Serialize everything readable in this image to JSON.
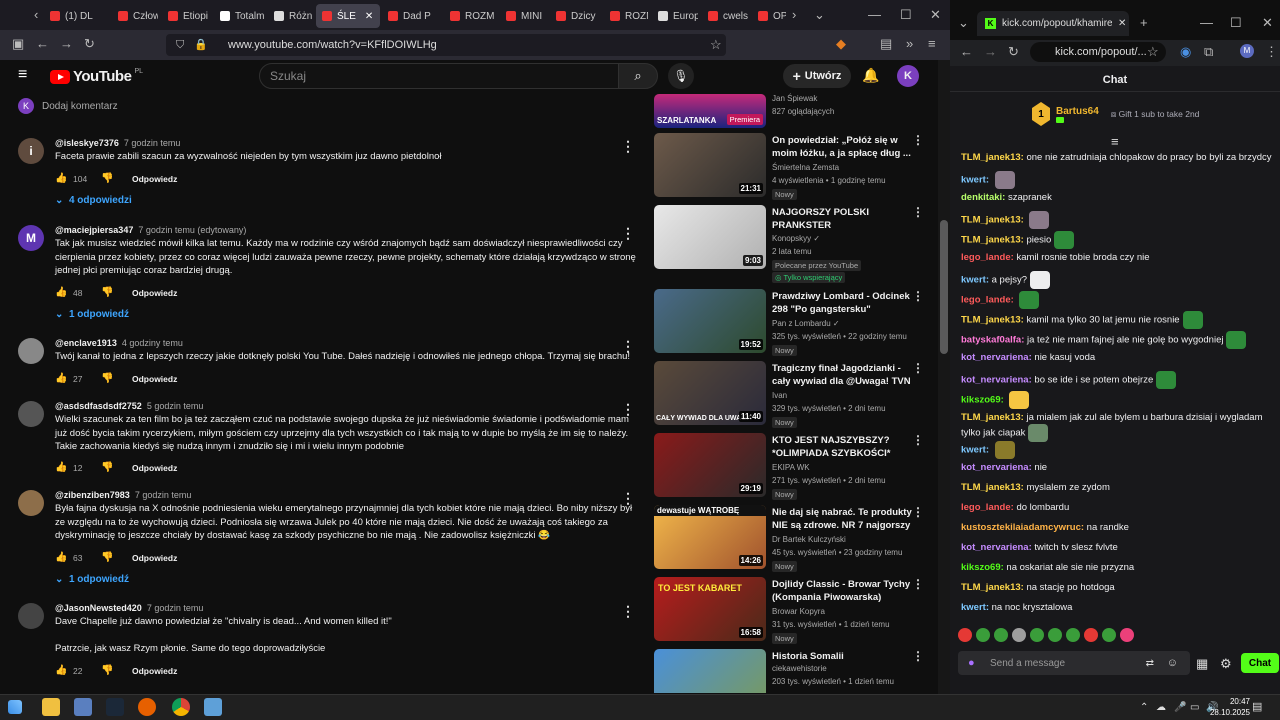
{
  "left_browser": {
    "tabs": [
      "(1) DL",
      "Człow",
      "Etiopi",
      "Totalm",
      "Różni",
      "ŚLE",
      "Dad P",
      "ROZM",
      "MINI",
      "Dzicy",
      "ROZM",
      "Europ",
      "cwels",
      "OPE"
    ],
    "url": "www.youtube.com/watch?v=KFflDOIWLHg"
  },
  "youtube": {
    "logo": "YouTube",
    "region": "PL",
    "search_placeholder": "Szukaj",
    "create_label": "Utwórz",
    "avatar_letter": "K",
    "add_comment": "Dodaj komentarz",
    "add_comment_avatar": "K",
    "comments": [
      {
        "author": "@isleskye7376",
        "time": "7 godzin temu",
        "text": "Faceta prawie zabili szacun za wyzwalność niejeden by tym wszystkim juz dawno pietdolnoł",
        "likes": "104",
        "reply": "Odpowiedz",
        "replies": "4 odpowiedzi",
        "avatar": "i",
        "color": "#5f4b3e"
      },
      {
        "author": "@maciejpiersa347",
        "time": "7 godzin temu (edytowany)",
        "text": "Tak jak musisz wiedzieć mówił kilka lat temu. Każdy ma w rodzinie czy wśród znajomych bądź sam doświadczył niesprawiedliwości czy cierpienia przez kobiety, przez co coraz więcej ludzi zauważa pewne rzeczy, pewne projekty, schematy które działają krzywdząco w stronę jednej płci premiując coraz bardziej drugą.",
        "likes": "48",
        "reply": "Odpowiedz",
        "replies": "1 odpowiedź",
        "avatar": "M",
        "color": "#5e35b1"
      },
      {
        "author": "@enclave1913",
        "time": "4 godziny temu",
        "text": "Twój kanał to jedna z lepszych rzeczy jakie dotknęły polski You Tube. Dałeś nadzieję i odnowiłeś nie jednego chłopa. Trzymaj się brachu!",
        "likes": "27",
        "reply": "Odpowiedz",
        "replies": "",
        "avatar": "",
        "color": "#888"
      },
      {
        "author": "@asdsdfasdsdf2752",
        "time": "5 godzin temu",
        "text": "Wielki szacunek za ten film bo ja też zacząłem czuć na podstawie swojego dupska że już nieświadomie świadomie i podświadomie mam już dość bycia takim rycerzykiem, miłym gościem czy uprzejmy dla tych wszystkich co i tak mają to w dupie bo myślą że im się to należy. Takie zachowania kiedyś się nudzą innym i znudziło się  i mi i wielu innym podobnie",
        "likes": "12",
        "reply": "Odpowiedz",
        "replies": "",
        "avatar": "",
        "color": "#555"
      },
      {
        "author": "@zibenziben7983",
        "time": "7 godzin temu",
        "text": "Była fajna dyskusja na X odnośnie podniesienia wieku emerytalnego przynajmniej dla tych kobiet które nie mają dzieci. Bo niby niższy był ze względu na to że wychowują dzieci. Podniosła się wrzawa Julek po 40 które nie mają dzieci. Nie dość że uważają coś takiego za dyskryminację to jeszcze chciały  by dostawać kasę za szkody psychiczne bo nie mają . Nie zadowolisz księżniczki 😂",
        "likes": "63",
        "reply": "Odpowiedz",
        "replies": "1 odpowiedź",
        "avatar": "",
        "color": "#8d6e4a"
      },
      {
        "author": "@JasonNewsted420",
        "time": "7 godzin temu",
        "text": "Dave Chapelle już dawno powiedział że \"chivalry is dead... And women killed it!\"\n\nPatrzcie, jak wasz Rzym płonie. Same do tego doprowadziłyście",
        "likes": "22",
        "reply": "Odpowiedz",
        "replies": "",
        "avatar": "",
        "color": "#444"
      }
    ],
    "recommendations": [
      {
        "title": "",
        "channel": "Jan Śpiewak",
        "meta": "827 oglądających",
        "duration": "",
        "badge": "Premiera",
        "thumb_text": "SZARLATANKA"
      },
      {
        "title": "On powiedział: „Połóż się w moim łóżku, a ja spłacę dług ...",
        "channel": "Śmiertelna Zemsta",
        "meta": "4 wyświetlenia • 1 godzinę temu",
        "duration": "21:31",
        "badge": "Nowy"
      },
      {
        "title": "NAJGORSZY POLSKI PRANKSTER",
        "channel": "Konopskyy ✓",
        "meta": "2 lata temu",
        "duration": "9:03",
        "badge": "Polecane przez YouTube",
        "badge2": "Tylko wspierający"
      },
      {
        "title": "Prawdziwy Lombard - Odcinek 298 \"Po gangstersku\"",
        "channel": "Pan z Lombardu ✓",
        "meta": "325 tys. wyświetleń • 22 godziny temu",
        "duration": "19:52",
        "badge": "Nowy"
      },
      {
        "title": "Tragiczny finał Jagodzianki - cały wywiad dla @Uwaga! TVN",
        "channel": "Ivan",
        "meta": "329 tys. wyświetleń • 2 dni temu",
        "duration": "11:40",
        "badge": "Nowy",
        "thumb_text": "CAŁY WYWIAD DLA UWAGA"
      },
      {
        "title": "KTO JEST NAJSZYBSZY? *OLIMPIADA SZYBKOŚCI*",
        "channel": "EKIPA WK",
        "meta": "271 tys. wyświetleń • 2 dni temu",
        "duration": "29:19",
        "badge": "Nowy"
      },
      {
        "title": "Nie daj się nabrać. Te produkty NIE są zdrowe. NR 7 najgorszy",
        "channel": "Dr Bartek Kulczyński",
        "meta": "45 tys. wyświetleń • 23 godziny temu",
        "duration": "14:26",
        "badge": "Nowy",
        "thumb_text": "dewastuje WĄTROBĘ"
      },
      {
        "title": "Dojlidy Classic - Browar Tychy (Kompania Piwowarska)",
        "channel": "Browar Kopyra",
        "meta": "31 tys. wyświetleń • 1 dzień temu",
        "duration": "16:58",
        "badge": "Nowy",
        "thumb_text": "TO JEST KABARET"
      },
      {
        "title": "Historia Somalii",
        "channel": "ciekawehistorie",
        "meta": "203 tys. wyświetleń • 1 dzień temu",
        "duration": "",
        "badge": ""
      }
    ]
  },
  "right_browser": {
    "tab_title": "kick.com/popout/khamires/cha",
    "url": "kick.com/popout/...",
    "chat_title": "Chat",
    "gifter": "Bartus64",
    "gifter_rank": "1",
    "gift_text": "Gift 1 sub to take 2nd",
    "messages": [
      {
        "user": "TLM_janek13:",
        "text": "one nie zatrudniaja chlopakow do pracy bo byli za brzydcy",
        "color": "#ffd84a"
      },
      {
        "user": "kwert:",
        "text": "",
        "color": "#7ec8ff"
      },
      {
        "user": "denkitaki:",
        "text": "szapranek",
        "color": "#b8ff6b"
      },
      {
        "user": "TLM_janek13:",
        "text": "",
        "color": "#ffd84a"
      },
      {
        "user": "TLM_janek13:",
        "text": "piesio",
        "color": "#ffd84a"
      },
      {
        "user": "lego_lande:",
        "text": "kamil rosnie tobie broda czy nie",
        "color": "#ff5b5b"
      },
      {
        "user": "kwert:",
        "text": "a pejsy?",
        "color": "#7ec8ff"
      },
      {
        "user": "lego_lande:",
        "text": "",
        "color": "#ff5b5b"
      },
      {
        "user": "TLM_janek13:",
        "text": "kamil ma tylko 30 lat jemu nie rosnie",
        "color": "#ffd84a"
      },
      {
        "user": "batyskaf0alfa:",
        "text": "ja też nie mam fajnej ale nie golę bo wygodniej",
        "color": "#ff7bd8"
      },
      {
        "user": "kot_nervariena:",
        "text": "nie kasuj voda",
        "color": "#c58cff"
      },
      {
        "user": "kot_nervariena:",
        "text": "bo se ide i se potem obejrze",
        "color": "#c58cff"
      },
      {
        "user": "kikszo69:",
        "text": "",
        "color": "#53fc18"
      },
      {
        "user": "TLM_janek13:",
        "text": "ja mialem jak zul ale bylem u barbura dzisiaj i wygladam tylko jak ciapak",
        "color": "#ffd84a"
      },
      {
        "user": "kwert:",
        "text": "",
        "color": "#7ec8ff"
      },
      {
        "user": "kot_nervariena:",
        "text": "nie",
        "color": "#c58cff"
      },
      {
        "user": "TLM_janek13:",
        "text": "myslalem ze zydom",
        "color": "#ffd84a"
      },
      {
        "user": "lego_lande:",
        "text": "do lombardu",
        "color": "#ff5b5b"
      },
      {
        "user": "kustosztekilaiadamcywruc:",
        "text": "na randke",
        "color": "#ffb347"
      },
      {
        "user": "kot_nervariena:",
        "text": "twitch tv slesz fvlvte",
        "color": "#c58cff"
      },
      {
        "user": "kikszo69:",
        "text": "na oskariat ale sie nie przyzna",
        "color": "#53fc18"
      },
      {
        "user": "TLM_janek13:",
        "text": "na stację po hotdoga",
        "color": "#ffd84a"
      },
      {
        "user": "kwert:",
        "text": "na noc krysztalowa",
        "color": "#7ec8ff"
      }
    ],
    "input_placeholder": "Send a message",
    "send_label": "Chat"
  },
  "taskbar": {
    "time": "20:47",
    "date": "28.10.2025"
  }
}
